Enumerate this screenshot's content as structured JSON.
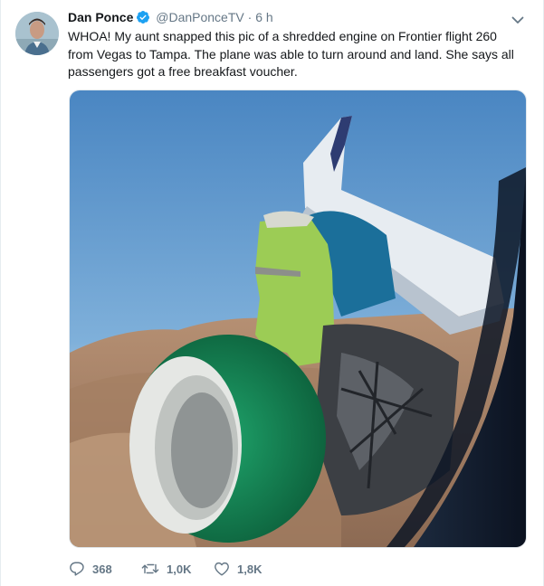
{
  "tweet": {
    "author_name": "Dan Ponce",
    "handle": "@DanPonceTV",
    "separator": "·",
    "time": "6 h",
    "text": "WHOA! My aunt snapped this pic of a shredded engine on Frontier flight 260\nfrom Vegas to Tampa.  The plane was able to turn around and land. She says all\npassengers got a free breakfast voucher.",
    "actions": {
      "replies": "368",
      "retweets": "1,0K",
      "likes": "1,8K"
    }
  },
  "icons": {
    "verified": "verified-badge-icon",
    "menu": "chevron-down-icon",
    "reply": "reply-icon",
    "retweet": "retweet-icon",
    "like": "heart-icon"
  },
  "colors": {
    "verified": "#1da1f2",
    "secondary_text": "#657786",
    "engine_green": "#1a8a5a",
    "fan_cowl": "#9ccc55"
  }
}
